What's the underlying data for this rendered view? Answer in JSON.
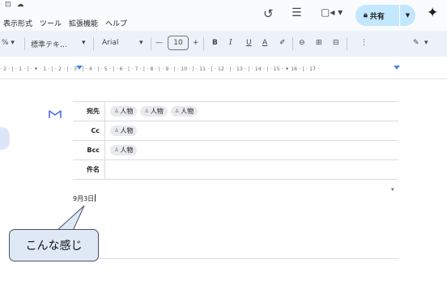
{
  "top_icons": [
    "⊡",
    "☁"
  ],
  "menus": [
    "表示形式",
    "ツール",
    "拡張機能",
    "ヘルプ"
  ],
  "share": {
    "label": "共有"
  },
  "toolbar": {
    "style_select": "標準テキ…",
    "font_select": "Arial",
    "font_size": "10",
    "minus": "—",
    "plus": "+",
    "bold": "B",
    "italic": "I",
    "underline": "U",
    "text_color": "A",
    "highlight": "✐",
    "link": "⊖",
    "insert_comment": "⊞",
    "image": "⊟",
    "more": "⋮",
    "edit_mode": "✎"
  },
  "ruler": {
    "text": "· 2 · | · 1 · | · ⯆ · 1 · | · 2 · | · 3 · | · 4 · | · 5 · | · 6 · | · 7 · | · 8 · | · 9 · | · 10 · | · 11 · | · 12 · | · 13 · | · 14 · | · 15 · ⯆ 16 · | · 17 ·"
  },
  "email_draft": {
    "rows": [
      {
        "label": "宛先",
        "chips": [
          "人物",
          "人物",
          "人物"
        ]
      },
      {
        "label": "Cc",
        "chips": [
          "人物"
        ]
      },
      {
        "label": "Bcc",
        "chips": [
          "人物"
        ]
      },
      {
        "label": "件名",
        "chips": []
      }
    ],
    "body_text": "9月3日"
  },
  "callout": {
    "text": "こんな感じ"
  },
  "colors": {
    "share_bg": "#c2e7ff",
    "toolbar_bg": "#edf2fa",
    "callout_bg": "#dfe8f5",
    "gmail_red": "#4a6cf7"
  }
}
